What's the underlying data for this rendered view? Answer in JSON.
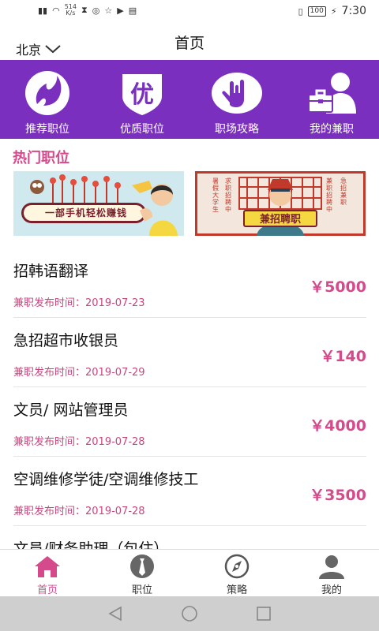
{
  "status": {
    "net_speed": "514",
    "net_unit": "K/s",
    "battery": "100",
    "time": "7:30"
  },
  "header": {
    "city": "北京",
    "title": "首页"
  },
  "categories": [
    {
      "label": "推荐职位",
      "icon": "fire-icon"
    },
    {
      "label": "优质职位",
      "icon": "quality-shield-icon"
    },
    {
      "label": "职场攻略",
      "icon": "hand-gesture-icon"
    },
    {
      "label": "我的兼职",
      "icon": "user-briefcase-icon"
    }
  ],
  "section": {
    "title": "热门职位"
  },
  "banners": [
    {
      "text": "一部手机轻松赚钱"
    },
    {
      "text": "兼招聘职",
      "left_text": "暑假大学生",
      "left_text2": "求职招聘中",
      "right_text": "兼职招聘中",
      "right_text2": "急招兼职"
    }
  ],
  "jobs": [
    {
      "title": "招韩语翻译",
      "date": "兼职发布时间：2019-07-23",
      "price": "￥5000"
    },
    {
      "title": "急招超市收银员",
      "date": "兼职发布时间：2019-07-29",
      "price": "￥140"
    },
    {
      "title": "文员/ 网站管理员",
      "date": "兼职发布时间：2019-07-28",
      "price": "￥4000"
    },
    {
      "title": "空调维修学徒/空调维修技工",
      "date": "兼职发布时间：2019-07-28",
      "price": "￥3500"
    },
    {
      "title": "文员/财务助理（包住）",
      "date": "",
      "price": ""
    }
  ],
  "tabs": [
    {
      "label": "首页",
      "icon": "home-icon",
      "active": true
    },
    {
      "label": "职位",
      "icon": "tie-icon",
      "active": false
    },
    {
      "label": "策略",
      "icon": "compass-icon",
      "active": false
    },
    {
      "label": "我的",
      "icon": "person-icon",
      "active": false
    }
  ],
  "colors": {
    "accent": "#d44a8a",
    "category_bar": "#7b2fbf",
    "nav_bar": "#cfcfcf"
  }
}
